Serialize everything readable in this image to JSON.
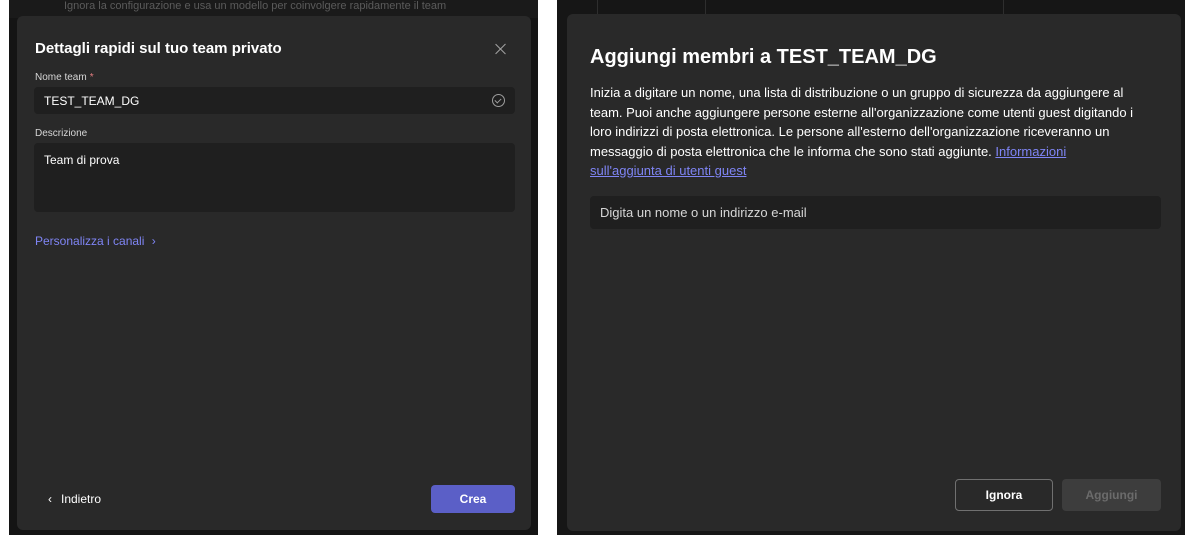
{
  "left_dialog": {
    "background_hint": "Ignora la configurazione e usa un modello per coinvolgere rapidamente il team",
    "title": "Dettagli rapidi sul tuo team privato",
    "team_name_label": "Nome team",
    "required_marker": "*",
    "team_name_value": "TEST_TEAM_DG",
    "description_label": "Descrizione",
    "description_value": "Team di prova",
    "customize_channels_link": "Personalizza i canali",
    "back_label": "Indietro",
    "create_label": "Crea"
  },
  "right_dialog": {
    "title": "Aggiungi membri a TEST_TEAM_DG",
    "description": "Inizia a digitare un nome, una lista di distribuzione o un gruppo di sicurezza da aggiungere al team. Puoi anche aggiungere persone esterne all'organizzazione come utenti guest digitando i loro indirizzi di posta elettronica. Le persone all'esterno dell'organizzazione riceveranno un messaggio di posta elettronica che le informa che sono stati aggiunte.",
    "guest_info_link": "Informazioni sull'aggiunta di utenti guest",
    "search_placeholder": "Digita un nome o un indirizzo e-mail",
    "ignore_label": "Ignora",
    "add_label": "Aggiungi"
  },
  "colors": {
    "accent": "#5b5fc7",
    "link": "#7f85f5",
    "panel_background": "#292929",
    "input_background": "#1f1f1f",
    "backdrop": "#141414"
  }
}
